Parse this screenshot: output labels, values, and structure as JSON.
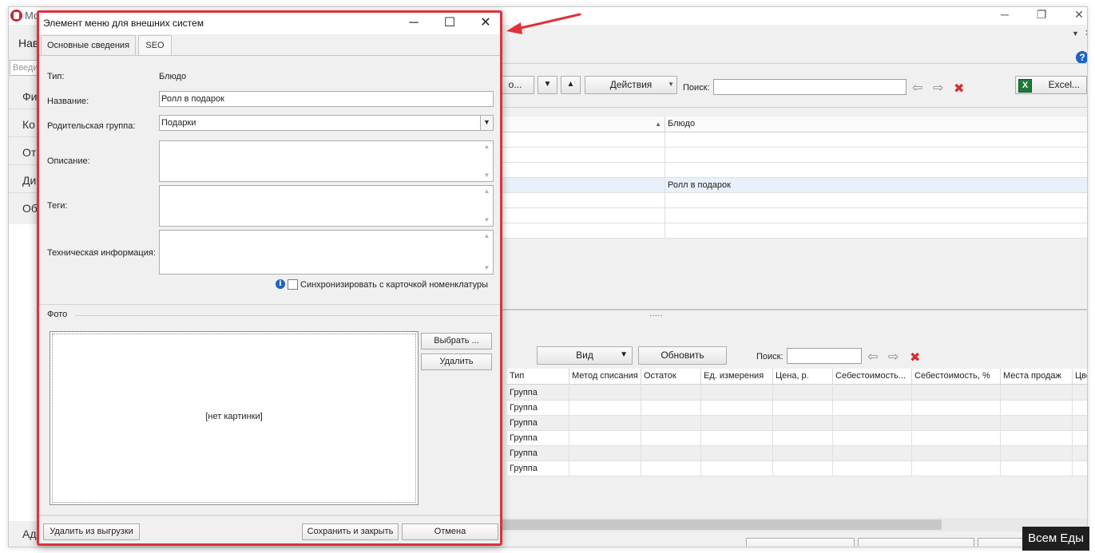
{
  "bg": {
    "app_title_fragment": "Мо",
    "nav_label": "Нав",
    "nav_search_placeholder": "Введи",
    "nav_items": [
      "Фи",
      "Ко",
      "От",
      "Ди",
      "Об"
    ],
    "nav_bottom": "Ад",
    "toolbar": {
      "dots_button": "о...",
      "actions_button": "Действия",
      "search_label": "Поиск:",
      "excel_button": "Excel..."
    },
    "grid1": {
      "header": "Блюдо",
      "rows": [
        "",
        "",
        "",
        "Ролл в подарок",
        "",
        "",
        ""
      ]
    },
    "splitter_dots": "·····",
    "toolbar2": {
      "view_button": "Вид",
      "refresh_button": "Обновить",
      "search_label": "Поиск:"
    },
    "grid2": {
      "columns": [
        "Тип",
        "Метод списания",
        "Остаток",
        "Ед. измерения",
        "Цена, р.",
        "Себестоимость...",
        "Себестоимость, %",
        "Места продаж",
        "Цве"
      ],
      "rows": [
        "Группа",
        "Группа",
        "Группа",
        "Группа",
        "Группа",
        "Группа"
      ]
    },
    "tooltip": "Всем Еды"
  },
  "dialog": {
    "title": "Элемент меню для внешних систем",
    "tabs": [
      "Основные сведения",
      "SEO"
    ],
    "type_label": "Тип:",
    "type_value": "Блюдо",
    "name_label": "Название:",
    "name_value": "Ролл в подарок",
    "parent_label": "Родительская группа:",
    "parent_value": "Подарки",
    "description_label": "Описание:",
    "tags_label": "Теги:",
    "tech_label": "Техническая информация:",
    "sync_label": "Синхронизировать с карточкой номенклатуры",
    "photo_label": "Фото",
    "no_image": "[нет картинки]",
    "choose_button": "Выбрать ...",
    "delete_button": "Удалить",
    "remove_export_button": "Удалить из выгрузки",
    "save_close_button": "Сохранить и закрыть",
    "cancel_button": "Отмена"
  },
  "colors": {
    "highlight_border": "#e0313b",
    "accent_blue": "#1e63c8"
  }
}
